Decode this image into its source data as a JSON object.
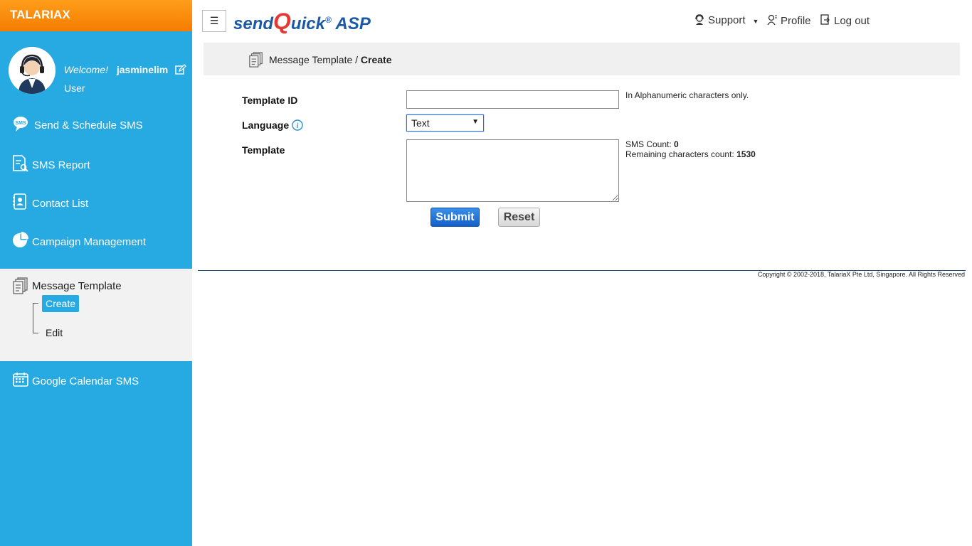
{
  "brand": "TALARIAX",
  "user": {
    "welcome": "Welcome!",
    "username": "jasminelim",
    "role": "User"
  },
  "sidebar": {
    "items": [
      {
        "label": "Send & Schedule SMS",
        "icon": "sms-bubble-icon"
      },
      {
        "label": "SMS Report",
        "icon": "report-icon"
      },
      {
        "label": "Contact List",
        "icon": "contact-icon"
      },
      {
        "label": "Campaign Management",
        "icon": "pie-chart-icon"
      },
      {
        "label": "Google Calendar SMS",
        "icon": "calendar-icon"
      }
    ],
    "active_group": {
      "label": "Message Template",
      "icon": "template-icon",
      "children": [
        {
          "label": "Create",
          "active": true
        },
        {
          "label": "Edit",
          "active": false
        }
      ]
    }
  },
  "header": {
    "menu_glyph": "☰",
    "logo": {
      "part1": "send",
      "q": "Q",
      "part2": "uick",
      "reg": "®",
      "suffix": " ASP"
    },
    "links": {
      "support": "Support",
      "profile": "Profile",
      "logout": "Log out"
    }
  },
  "breadcrumb": {
    "parent": "Message Template",
    "separator": " / ",
    "current": "Create"
  },
  "form": {
    "template_id": {
      "label": "Template ID",
      "value": "",
      "hint": "In Alphanumeric characters only."
    },
    "language": {
      "label": "Language",
      "selected": "Text"
    },
    "template": {
      "label": "Template",
      "value": ""
    },
    "sms_count_label": "SMS Count:",
    "sms_count": "0",
    "remaining_label": "Remaining characters count:",
    "remaining": "1530",
    "submit": "Submit",
    "reset": "Reset"
  },
  "footer": {
    "copyright": "Copyright © 2002-2018, TalariaX Pte Ltd, Singapore. All Rights Reserved"
  },
  "colors": {
    "sidebar": "#27a9e1",
    "brand_bar": "#f57c00",
    "submit": "#1460c9"
  }
}
